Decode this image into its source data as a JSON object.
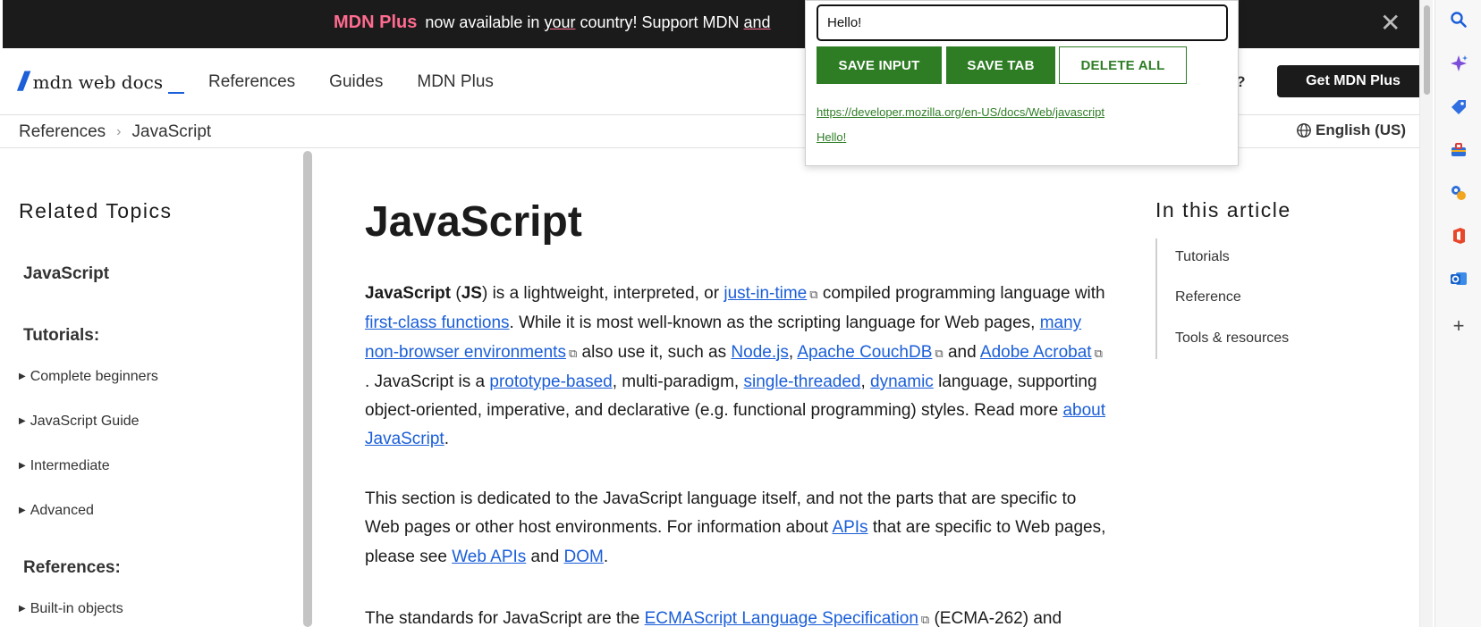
{
  "banner": {
    "brand": "MDN Plus",
    "message_a": " now available in ",
    "message_u": "your",
    "message_b": " country! Support MDN ",
    "message_c": "and"
  },
  "header": {
    "logo_text": "mdn web docs",
    "nav": [
      "References",
      "Guides",
      "MDN Plus"
    ],
    "login_partial": "er?",
    "cta": "Get MDN Plus"
  },
  "breadcrumb": [
    "References",
    "JavaScript"
  ],
  "language": "English (US)",
  "sidebar": {
    "heading": "Related Topics",
    "current": "JavaScript",
    "tutorials_heading": "Tutorials:",
    "tutorials": [
      "Complete beginners",
      "JavaScript Guide",
      "Intermediate",
      "Advanced"
    ],
    "references_heading": "References:",
    "references": [
      "Built-in objects"
    ]
  },
  "article": {
    "title": "JavaScript",
    "p1": {
      "b1": "JavaScript",
      "t1": " (",
      "b2": "JS",
      "t2": ") is a lightweight, interpreted, or ",
      "l1": "just-in-time",
      "t3": " compiled programming language with ",
      "l2": "first-class functions",
      "t4": ". While it is most well-known as the scripting language for Web pages, ",
      "l3": "many non-browser environments",
      "t5": " also use it, such as ",
      "l4": "Node.js",
      "t6": ", ",
      "l5": "Apache CouchDB",
      "t7": " and ",
      "l6": "Adobe Acrobat",
      "t8": ". JavaScript is a ",
      "l7": "prototype-based",
      "t9": ", multi-paradigm, ",
      "l8": "single-threaded",
      "t10": ", ",
      "l9": "dynamic",
      "t11": " language, supporting object-oriented, imperative, and declarative (e.g. functional programming) styles. Read more ",
      "l10": "about JavaScript",
      "t12": "."
    },
    "p2": {
      "t1": "This section is dedicated to the JavaScript language itself, and not the parts that are specific to Web pages or other host environments. For information about ",
      "l1": "APIs",
      "t2": " that are specific to Web pages, please see ",
      "l2": "Web APIs",
      "t3": " and ",
      "l3": "DOM",
      "t4": "."
    },
    "p3": {
      "t1": "The standards for JavaScript are the ",
      "l1": "ECMAScript Language Specification",
      "t2": " (ECMA-262) and"
    }
  },
  "toc": {
    "heading": "In this article",
    "items": [
      "Tutorials",
      "Reference",
      "Tools & resources"
    ]
  },
  "popup": {
    "input_value": "Hello!",
    "save_input": "SAVE INPUT",
    "save_tab": "SAVE TAB",
    "delete_all": "DELETE ALL",
    "links": [
      "https://developer.mozilla.org/en-US/docs/Web/javascript",
      "Hello!"
    ]
  },
  "colors": {
    "accent_link": "#1a5ed8",
    "plus_pink": "#ff6b8f",
    "popup_green": "#2e7d25",
    "banner_bg": "#1b1b1b"
  },
  "edge_icons": [
    "search-icon",
    "copilot-icon",
    "shopping-tag-icon",
    "tools-icon",
    "games-icon",
    "office-icon",
    "outlook-icon",
    "add-icon"
  ]
}
